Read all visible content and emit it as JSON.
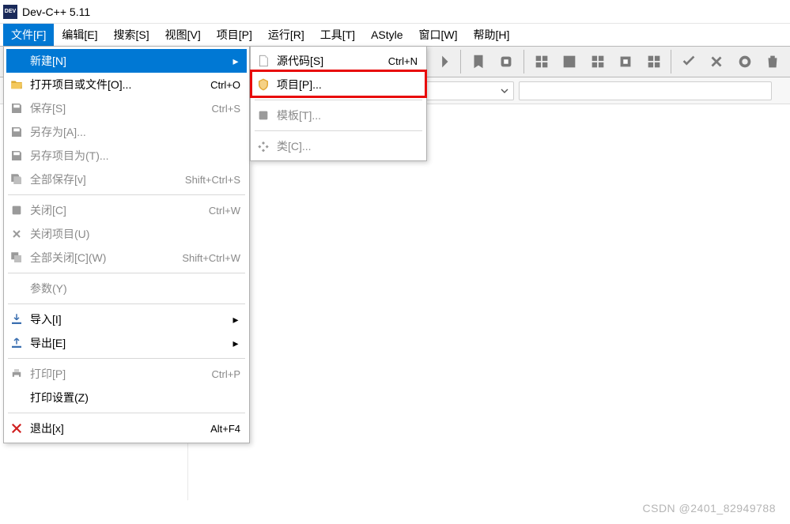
{
  "title": "Dev-C++ 5.11",
  "menubar": {
    "file": "文件[F]",
    "edit": "编辑[E]",
    "search": "搜索[S]",
    "view": "视图[V]",
    "project": "项目[P]",
    "run": "运行[R]",
    "tools": "工具[T]",
    "astyle": "AStyle",
    "window": "窗口[W]",
    "help": "帮助[H]"
  },
  "file_menu": {
    "new": "新建[N]",
    "open": "打开项目或文件[O]...",
    "open_sc": "Ctrl+O",
    "save": "保存[S]",
    "save_sc": "Ctrl+S",
    "save_as": "另存为[A]...",
    "save_project_as": "另存项目为(T)...",
    "save_all": "全部保存[v]",
    "save_all_sc": "Shift+Ctrl+S",
    "close": "关闭[C]",
    "close_sc": "Ctrl+W",
    "close_project": "关闭项目(U)",
    "close_all": "全部关闭[C](W)",
    "close_all_sc": "Shift+Ctrl+W",
    "properties": "参数(Y)",
    "import": "导入[I]",
    "export": "导出[E]",
    "print": "打印[P]",
    "print_sc": "Ctrl+P",
    "print_setup": "打印设置(Z)",
    "exit": "退出[x]",
    "exit_sc": "Alt+F4"
  },
  "new_submenu": {
    "source": "源代码[S]",
    "source_sc": "Ctrl+N",
    "project": "项目[P]...",
    "template": "模板[T]...",
    "class": "类[C]..."
  },
  "watermark": "CSDN @2401_82949788"
}
